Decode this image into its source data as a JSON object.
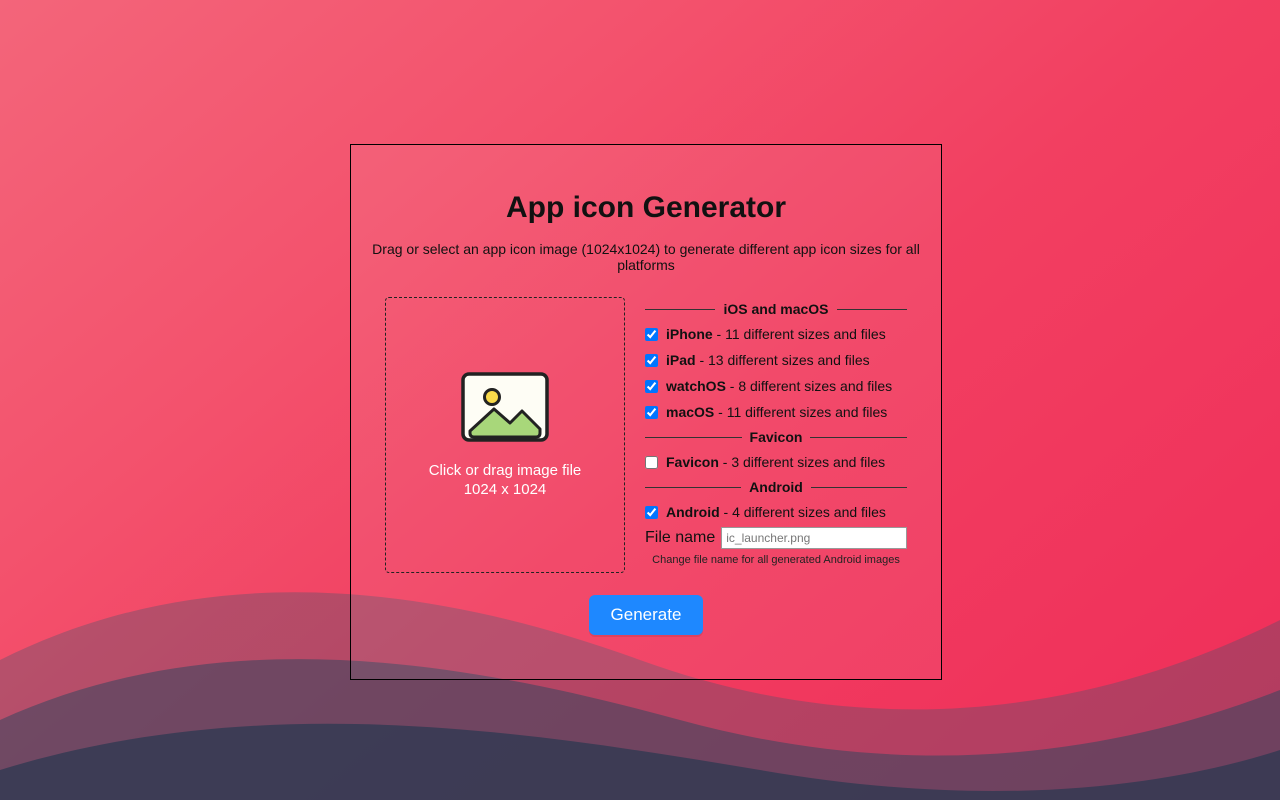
{
  "title": "App icon Generator",
  "subtitle": "Drag or select an app icon image (1024x1024) to generate different app icon sizes for all platforms",
  "dropzone": {
    "line1": "Click or drag image file",
    "line2": "1024 x 1024"
  },
  "groups": {
    "g1": "iOS and macOS",
    "g2": "Favicon",
    "g3": "Android"
  },
  "options": {
    "iphone": {
      "checked": true,
      "name": "iPhone",
      "desc": " - 11 different sizes and files"
    },
    "ipad": {
      "checked": true,
      "name": "iPad",
      "desc": " - 13 different sizes and files"
    },
    "watchos": {
      "checked": true,
      "name": "watchOS",
      "desc": " - 8 different sizes and files"
    },
    "macos": {
      "checked": true,
      "name": "macOS",
      "desc": " - 11 different sizes and files"
    },
    "favicon": {
      "checked": false,
      "name": "Favicon",
      "desc": " - 3 different sizes and files"
    },
    "android": {
      "checked": true,
      "name": "Android",
      "desc": " - 4 different sizes and files"
    }
  },
  "filename": {
    "label": "File name",
    "value": "ic_launcher.png",
    "hint": "Change file name for all generated Android images"
  },
  "generate_label": "Generate"
}
